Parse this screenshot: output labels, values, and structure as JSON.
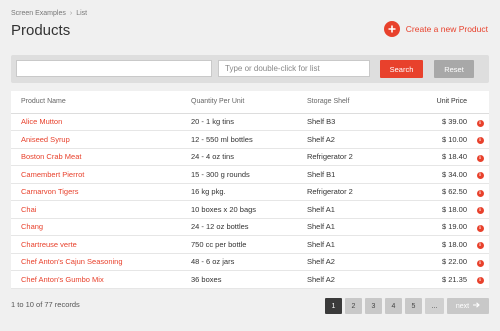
{
  "breadcrumb": {
    "root": "Screen Examples",
    "separator": "›",
    "current": "List"
  },
  "page": {
    "title": "Products"
  },
  "create_button": {
    "label": "Create a new Product",
    "icon": "plus-icon"
  },
  "search": {
    "query_value": "",
    "list_placeholder": "Type or double-click for list",
    "search_label": "Search",
    "reset_label": "Reset"
  },
  "table": {
    "headers": {
      "name": "Product Name",
      "qty": "Quantity Per Unit",
      "shelf": "Storage Shelf",
      "price": "Unit Price"
    },
    "rows": [
      {
        "name": "Alice Mutton",
        "qty": "20 - 1 kg tins",
        "shelf": "Shelf B3",
        "price": "$ 39.00"
      },
      {
        "name": "Aniseed Syrup",
        "qty": "12 - 550 ml bottles",
        "shelf": "Shelf A2",
        "price": "$ 10.00"
      },
      {
        "name": "Boston Crab Meat",
        "qty": "24 - 4 oz tins",
        "shelf": "Refrigerator 2",
        "price": "$ 18.40"
      },
      {
        "name": "Camembert Pierrot",
        "qty": "15 - 300 g rounds",
        "shelf": "Shelf B1",
        "price": "$ 34.00"
      },
      {
        "name": "Carnarvon Tigers",
        "qty": "16 kg pkg.",
        "shelf": "Refrigerator 2",
        "price": "$ 62.50"
      },
      {
        "name": "Chai",
        "qty": "10 boxes x 20 bags",
        "shelf": "Shelf A1",
        "price": "$ 18.00"
      },
      {
        "name": "Chang",
        "qty": "24 - 12 oz bottles",
        "shelf": "Shelf A1",
        "price": "$ 19.00"
      },
      {
        "name": "Chartreuse verte",
        "qty": "750 cc per bottle",
        "shelf": "Shelf A1",
        "price": "$ 18.00"
      },
      {
        "name": "Chef Anton's Cajun Seasoning",
        "qty": "48 - 6 oz jars",
        "shelf": "Shelf A2",
        "price": "$ 22.00"
      },
      {
        "name": "Chef Anton's Gumbo Mix",
        "qty": "36 boxes",
        "shelf": "Shelf A2",
        "price": "$ 21.35"
      }
    ]
  },
  "footer": {
    "records": "1 to 10 of 77 records"
  },
  "pager": {
    "pages": [
      "1",
      "2",
      "3",
      "4",
      "5"
    ],
    "active": "1",
    "ellipsis": "...",
    "next_label": "next"
  },
  "colors": {
    "accent": "#e8412c",
    "active_page": "#3a3a3a",
    "background": "#f0f0f0"
  }
}
